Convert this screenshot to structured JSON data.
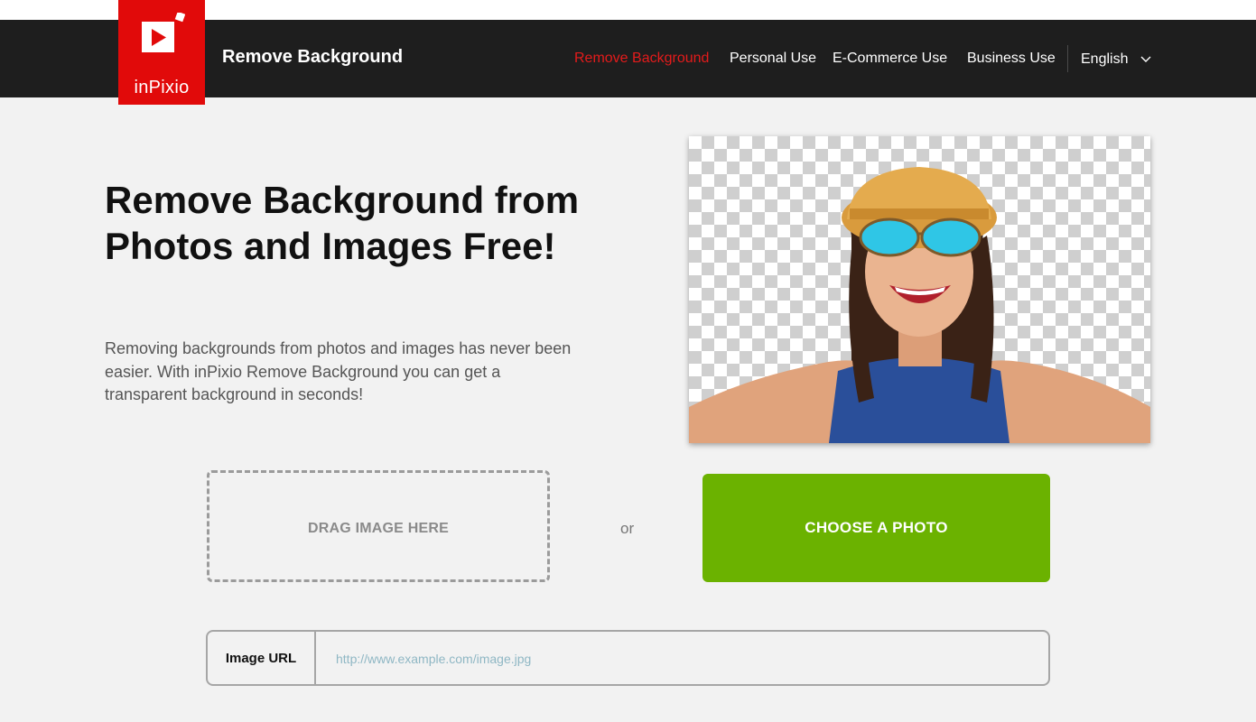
{
  "header": {
    "logo_text": "inPixio",
    "title": "Remove Background",
    "nav": [
      {
        "label": "Remove Background",
        "active": true
      },
      {
        "label": "Personal Use",
        "active": false
      },
      {
        "label": "E-Commerce Use",
        "active": false
      },
      {
        "label": "Business Use",
        "active": false
      }
    ],
    "language": "English"
  },
  "hero": {
    "title": "Remove Background from Photos and Images Free!",
    "description": "Removing backgrounds from photos and images has never been easier. With inPixio Remove Background you can get a transparent background in seconds!"
  },
  "upload": {
    "drag_label": "DRAG IMAGE HERE",
    "or_label": "or",
    "choose_label": "CHOOSE A PHOTO"
  },
  "url_field": {
    "label": "Image URL",
    "placeholder": "http://www.example.com/image.jpg",
    "value": ""
  },
  "colors": {
    "brand_red": "#e10a0a",
    "nav_active": "#e41b1b",
    "navbar_bg": "#1e1e1e",
    "cta_green": "#6bb200"
  },
  "icons": [
    "inpixio-logo-icon",
    "chevron-down-icon"
  ]
}
